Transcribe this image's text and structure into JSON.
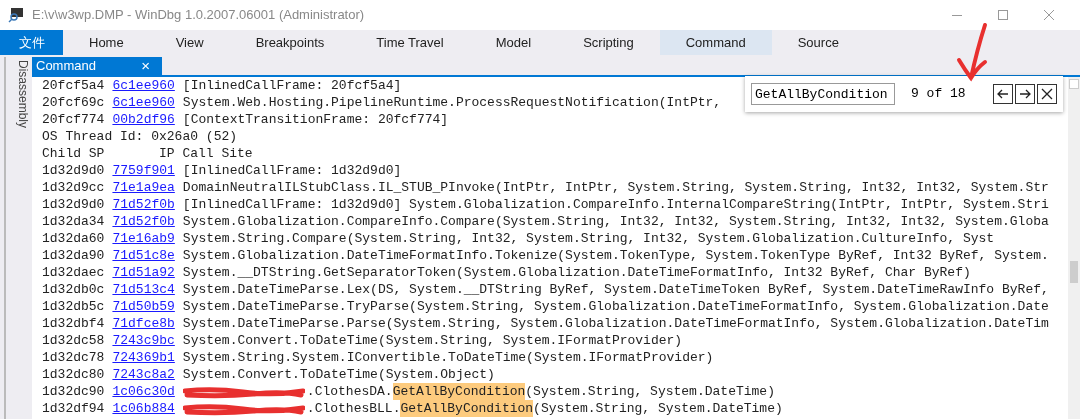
{
  "window": {
    "title": "E:\\v\\w3wp.DMP - WinDbg 1.0.2007.06001 (Administrator)"
  },
  "ribbon": {
    "tabs": [
      {
        "label": "文件",
        "kind": "file",
        "selected": false
      },
      {
        "label": "Home",
        "kind": "tab",
        "selected": false
      },
      {
        "label": "View",
        "kind": "tab",
        "selected": false
      },
      {
        "label": "Breakpoints",
        "kind": "tab",
        "selected": false
      },
      {
        "label": "Time Travel",
        "kind": "tab",
        "selected": false
      },
      {
        "label": "Model",
        "kind": "tab",
        "selected": false
      },
      {
        "label": "Scripting",
        "kind": "tab",
        "selected": false
      },
      {
        "label": "Command",
        "kind": "tab",
        "selected": true
      },
      {
        "label": "Source",
        "kind": "tab",
        "selected": false
      }
    ]
  },
  "side_panel": {
    "label": "Disassembly"
  },
  "document_tab": {
    "label": "Command",
    "close": "×"
  },
  "find": {
    "value": "GetAllByCondition",
    "count": "9 of 18"
  },
  "lines": [
    {
      "kind": "frame",
      "child_sp": "20fcf5a4",
      "ip": "6c1ee960",
      "call_site": [
        {
          "kind": "text",
          "text": "[InlinedCallFrame: 20fcf5a4]"
        }
      ]
    },
    {
      "kind": "frame",
      "child_sp": "20fcf69c",
      "ip": "6c1ee960",
      "call_site": [
        {
          "kind": "text",
          "text": "System.Web.Hosting.PipelineRuntime.ProcessRequestNotification(IntPtr,"
        }
      ]
    },
    {
      "kind": "frame",
      "child_sp": "20fcf774",
      "ip": "00b2df96",
      "call_site": [
        {
          "kind": "text",
          "text": "[ContextTransitionFrame: 20fcf774]"
        }
      ]
    },
    {
      "kind": "text",
      "text": "OS Thread Id: 0x26a0 (52)"
    },
    {
      "kind": "text",
      "text": "Child SP       IP Call Site"
    },
    {
      "kind": "frame",
      "child_sp": "1d32d9d0",
      "ip": "7759f901",
      "call_site": [
        {
          "kind": "text",
          "text": "[InlinedCallFrame: 1d32d9d0]"
        }
      ]
    },
    {
      "kind": "frame",
      "child_sp": "1d32d9cc",
      "ip": "71e1a9ea",
      "call_site": [
        {
          "kind": "text",
          "text": "DomainNeutralILStubClass.IL_STUB_PInvoke(IntPtr, IntPtr, System.String, System.String, Int32, Int32, System.Str"
        }
      ]
    },
    {
      "kind": "frame",
      "child_sp": "1d32d9d0",
      "ip": "71d52f0b",
      "call_site": [
        {
          "kind": "text",
          "text": "[InlinedCallFrame: 1d32d9d0] System.Globalization.CompareInfo.InternalCompareString(IntPtr, IntPtr, System.Stri"
        }
      ]
    },
    {
      "kind": "frame",
      "child_sp": "1d32da34",
      "ip": "71d52f0b",
      "call_site": [
        {
          "kind": "text",
          "text": "System.Globalization.CompareInfo.Compare(System.String, Int32, Int32, System.String, Int32, Int32, System.Globa"
        }
      ]
    },
    {
      "kind": "frame",
      "child_sp": "1d32da60",
      "ip": "71e16ab9",
      "call_site": [
        {
          "kind": "text",
          "text": "System.String.Compare(System.String, Int32, System.String, Int32, System.Globalization.CultureInfo, Syst"
        }
      ]
    },
    {
      "kind": "frame",
      "child_sp": "1d32da90",
      "ip": "71d51c8e",
      "call_site": [
        {
          "kind": "text",
          "text": "System.Globalization.DateTimeFormatInfo.Tokenize(System.TokenType, System.TokenType ByRef, Int32 ByRef, System."
        }
      ]
    },
    {
      "kind": "frame",
      "child_sp": "1d32daec",
      "ip": "71d51a92",
      "call_site": [
        {
          "kind": "text",
          "text": "System.__DTString.GetSeparatorToken(System.Globalization.DateTimeFormatInfo, Int32 ByRef, Char ByRef)"
        }
      ]
    },
    {
      "kind": "frame",
      "child_sp": "1d32db0c",
      "ip": "71d513c4",
      "call_site": [
        {
          "kind": "text",
          "text": "System.DateTimeParse.Lex(DS, System.__DTString ByRef, System.DateTimeToken ByRef, System.DateTimeRawInfo ByRef,"
        }
      ]
    },
    {
      "kind": "frame",
      "child_sp": "1d32db5c",
      "ip": "71d50b59",
      "call_site": [
        {
          "kind": "text",
          "text": "System.DateTimeParse.TryParse(System.String, System.Globalization.DateTimeFormatInfo, System.Globalization.Date"
        }
      ]
    },
    {
      "kind": "frame",
      "child_sp": "1d32dbf4",
      "ip": "71dfce8b",
      "call_site": [
        {
          "kind": "text",
          "text": "System.DateTimeParse.Parse(System.String, System.Globalization.DateTimeFormatInfo, System.Globalization.DateTim"
        }
      ]
    },
    {
      "kind": "frame",
      "child_sp": "1d32dc58",
      "ip": "7243c9bc",
      "call_site": [
        {
          "kind": "text",
          "text": "System.Convert.ToDateTime(System.String, System.IFormatProvider)"
        }
      ]
    },
    {
      "kind": "frame",
      "child_sp": "1d32dc78",
      "ip": "724369b1",
      "call_site": [
        {
          "kind": "text",
          "text": "System.String.System.IConvertible.ToDateTime(System.IFormatProvider)"
        }
      ]
    },
    {
      "kind": "frame",
      "child_sp": "1d32dc80",
      "ip": "7243c8a2",
      "call_site": [
        {
          "kind": "text",
          "text": "System.Convert.ToDateTime(System.Object)"
        }
      ]
    },
    {
      "kind": "frame",
      "child_sp": "1d32dc90",
      "ip": "1c06c30d",
      "call_site": [
        {
          "kind": "redacted"
        },
        {
          "kind": "text",
          "text": ".ClothesDA."
        },
        {
          "kind": "highlight",
          "text": "GetAllByCondition"
        },
        {
          "kind": "text",
          "text": "(System.String, System.DateTime)"
        }
      ]
    },
    {
      "kind": "frame",
      "child_sp": "1d32df94",
      "ip": "1c06b884",
      "call_site": [
        {
          "kind": "redacted"
        },
        {
          "kind": "text",
          "text": ".ClothesBLL."
        },
        {
          "kind": "highlight",
          "text": "GetAllByCondition"
        },
        {
          "kind": "text",
          "text": "(System.String, System.DateTime)"
        }
      ]
    }
  ]
}
